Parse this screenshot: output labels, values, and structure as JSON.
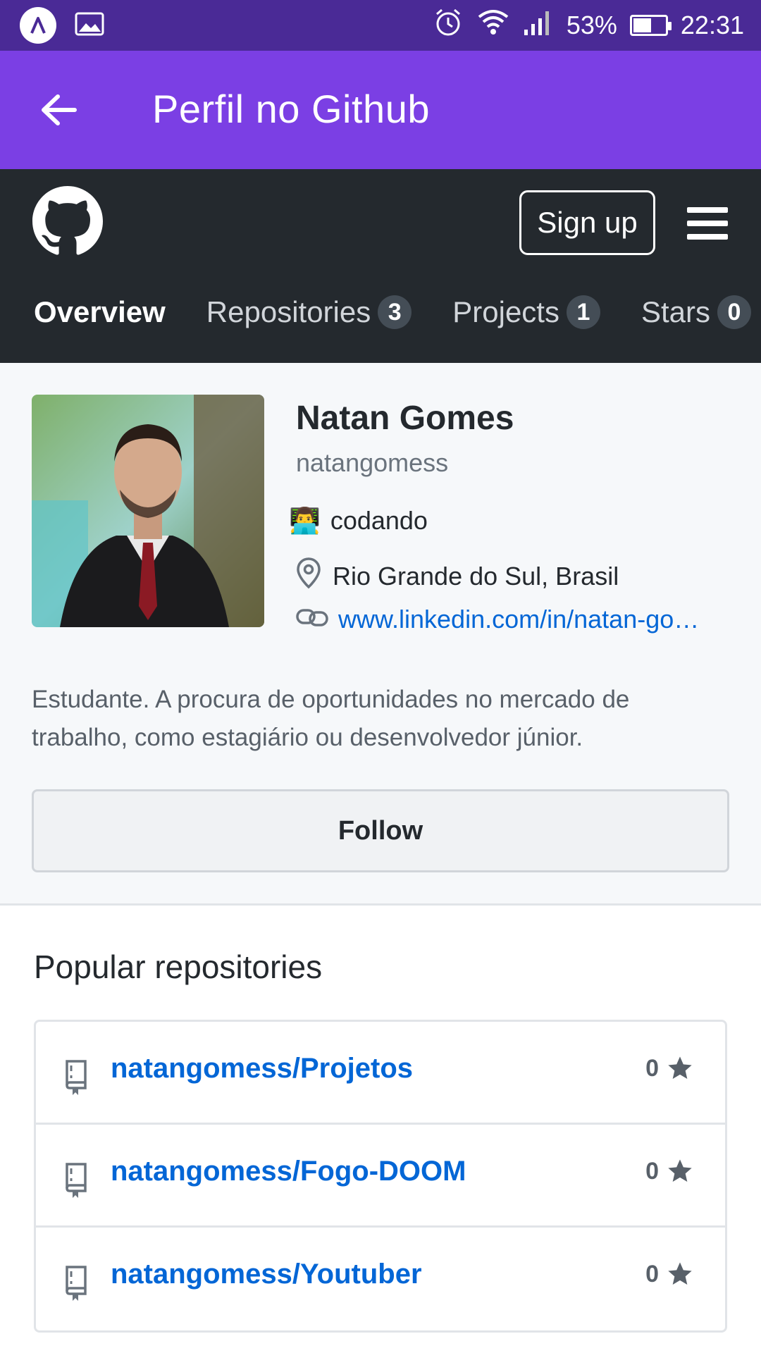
{
  "status_bar": {
    "battery": "53%",
    "time": "22:31",
    "icons": [
      "app-icon",
      "image-icon",
      "alarm-icon",
      "wifi-icon",
      "signal-icon",
      "battery-icon"
    ]
  },
  "app_bar": {
    "title": "Perfil no Github",
    "back_icon": "arrow-left-icon",
    "color": "#7b3fe4"
  },
  "github_header": {
    "signup_label": "Sign up",
    "logo_icon": "github-logo-icon",
    "menu_icon": "hamburger-menu-icon",
    "tabs": [
      {
        "label": "Overview",
        "active": true
      },
      {
        "label": "Repositories",
        "count": "3"
      },
      {
        "label": "Projects",
        "count": "1"
      },
      {
        "label": "Stars",
        "count": "0"
      }
    ]
  },
  "profile": {
    "name": "Natan Gomes",
    "login": "natangomess",
    "status": "codando",
    "status_emoji": "👨‍💻",
    "location": "Rio Grande do Sul, Brasil",
    "website": "www.linkedin.com/in/natan-go…",
    "bio": "Estudante. A procura de oportunidades no mercado de trabalho, como estagiário ou desenvolvedor júnior.",
    "follow_label": "Follow"
  },
  "popular": {
    "title": "Popular repositories",
    "repos": [
      {
        "name": "natangomess/Projetos",
        "stars": "0"
      },
      {
        "name": "natangomess/Fogo-DOOM",
        "stars": "0"
      },
      {
        "name": "natangomess/Youtuber",
        "stars": "0"
      }
    ]
  }
}
